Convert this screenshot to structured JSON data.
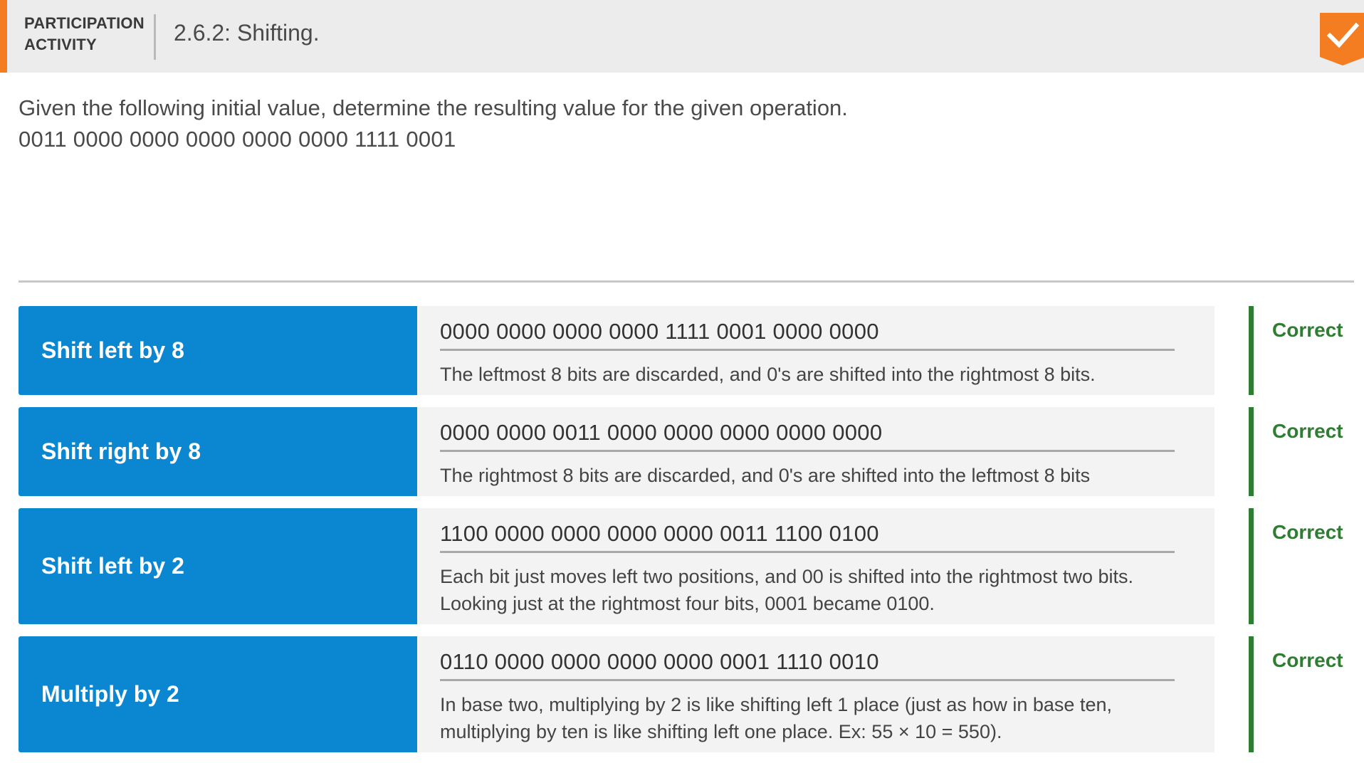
{
  "header": {
    "badge_line1": "PARTICIPATION",
    "badge_line2": "ACTIVITY",
    "title": "2.6.2: Shifting.",
    "completion_icon": "check-icon",
    "accent_color": "#f47d21"
  },
  "question": {
    "instructions": "Given the following initial value, determine the resulting value for the given operation.",
    "initial_value": "0011 0000 0000 0000 0000 0000 1111 0001"
  },
  "rows": [
    {
      "prompt": "Shift left by 8",
      "answer": "0000 0000 0000 0000 1111 0001 0000 0000",
      "explanation": "The leftmost 8 bits are discarded, and 0's are shifted into the rightmost 8 bits.",
      "feedback": "Correct"
    },
    {
      "prompt": "Shift right by 8",
      "answer": "0000 0000 0011 0000 0000 0000 0000 0000",
      "explanation": "The rightmost 8 bits are discarded, and 0's are shifted into the leftmost 8 bits",
      "feedback": "Correct"
    },
    {
      "prompt": "Shift left by 2",
      "answer": "1100 0000 0000 0000 0000 0011 1100 0100",
      "explanation": "Each bit just moves left two positions, and 00 is shifted into the rightmost two bits. Looking just at the rightmost four bits, 0001 became 0100.",
      "feedback": "Correct"
    },
    {
      "prompt": "Multiply by 2",
      "answer": "0110 0000 0000 0000 0000 0001 1110 0010",
      "explanation": "In base two, multiplying by 2 is like shifting left 1 place (just as how in base ten, multiplying by ten is like shifting left one place. Ex: 55 × 10 = 550).",
      "feedback": "Correct"
    }
  ],
  "colors": {
    "prompt_bg": "#0b86d1",
    "correct": "#2e7d32"
  }
}
